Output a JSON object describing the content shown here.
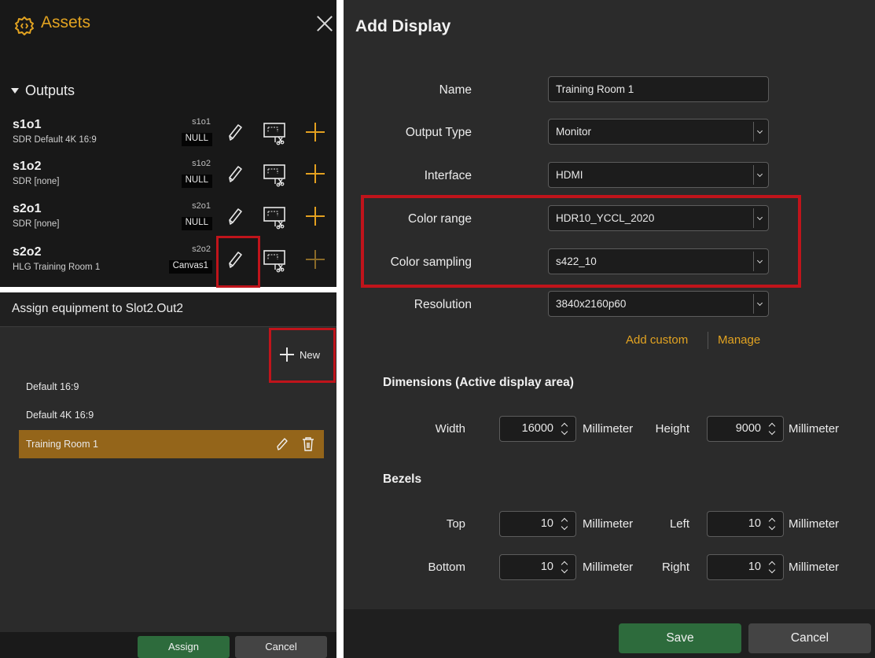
{
  "assets": {
    "title": "Assets",
    "section_title": "Outputs",
    "outputs": [
      {
        "name": "s1o1",
        "desc": "SDR  Default 4K 16:9",
        "slot": "s1o1",
        "tag": "NULL"
      },
      {
        "name": "s1o2",
        "desc": "SDR  [none]",
        "slot": "s1o2",
        "tag": "NULL"
      },
      {
        "name": "s2o1",
        "desc": "SDR  [none]",
        "slot": "s2o1",
        "tag": "NULL"
      },
      {
        "name": "s2o2",
        "desc": "HLG  Training Room 1",
        "slot": "s2o2",
        "tag": "Canvas1"
      }
    ],
    "accent_color": "#e2a321",
    "icons": [
      "gear-icon",
      "close-icon",
      "caret-down-icon",
      "pencil-icon",
      "crop-icon",
      "plus-icon"
    ]
  },
  "assign": {
    "title": "Assign equipment to Slot2.Out2",
    "new_label": "New",
    "items": [
      "Default 16:9",
      "Default 4K 16:9",
      "Training Room 1"
    ],
    "selected_index": 2,
    "assign_label": "Assign",
    "cancel_label": "Cancel",
    "selected_color": "#94651a"
  },
  "dialog": {
    "title": "Add Display",
    "fields": {
      "name": {
        "label": "Name",
        "value": "Training Room 1"
      },
      "output_type": {
        "label": "Output Type",
        "value": "Monitor"
      },
      "interface": {
        "label": "Interface",
        "value": "HDMI"
      },
      "color_range": {
        "label": "Color range",
        "value": "HDR10_YCCL_2020"
      },
      "color_sampling": {
        "label": "Color sampling",
        "value": "s422_10"
      },
      "resolution": {
        "label": "Resolution",
        "value": "3840x2160p60"
      }
    },
    "add_custom": "Add custom",
    "manage": "Manage",
    "dimensions": {
      "heading": "Dimensions (Active display area)",
      "width_label": "Width",
      "width_value": "16000",
      "height_label": "Height",
      "height_value": "9000",
      "unit": "Millimeter"
    },
    "bezels": {
      "heading": "Bezels",
      "top_label": "Top",
      "top_value": "10",
      "left_label": "Left",
      "left_value": "10",
      "bottom_label": "Bottom",
      "bottom_value": "10",
      "right_label": "Right",
      "right_value": "10",
      "unit": "Millimeter"
    },
    "save_label": "Save",
    "cancel_label": "Cancel",
    "save_color": "#2d6b3c",
    "highlight_color": "#c0141b"
  }
}
